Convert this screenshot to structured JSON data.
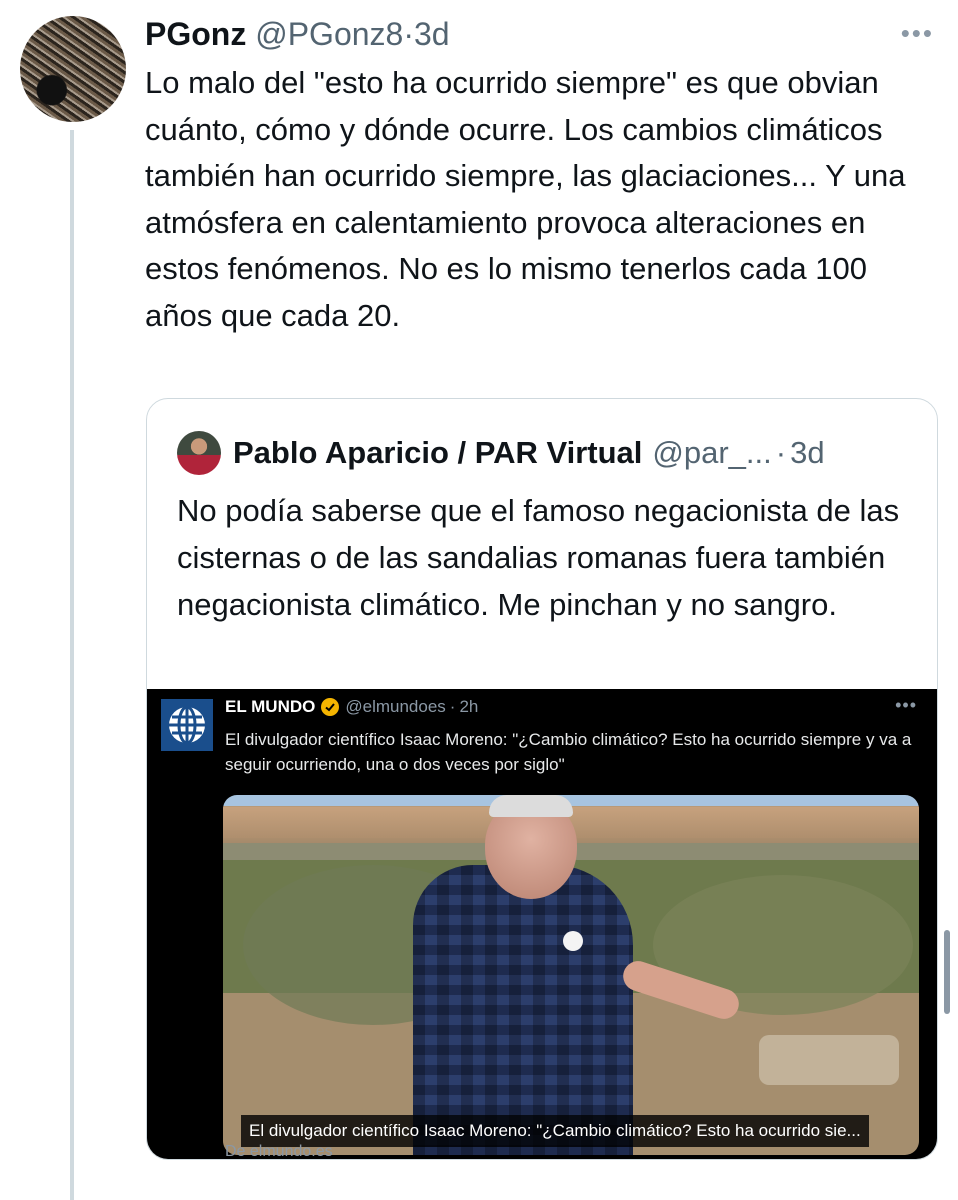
{
  "post": {
    "name": "PGonz",
    "handle": "@PGonz8",
    "separator": "·",
    "time": "3d",
    "more": "•••",
    "text": "Lo malo del \"esto ha ocurrido siempre\" es que obvian cuánto, cómo y dónde ocurre. Los cambios climáticos también han ocurrido siempre, las glaciaciones... Y una atmósfera en calentamiento provoca alteraciones en estos fenómenos. No es lo mismo tenerlos cada 100 años que cada 20."
  },
  "quote": {
    "name": "Pablo Aparicio / PAR Virtual",
    "handle": "@par_...",
    "separator": "·",
    "time": "3d",
    "text": "No podía saberse que el famoso negacionista de las cisternas o de las sandalias romanas fuera también negacionista climático. Me pinchan y no sangro."
  },
  "embedded": {
    "name": "EL MUNDO",
    "handle": "@elmundoes",
    "separator": "·",
    "time": "2h",
    "more": "•••",
    "text": "El divulgador científico Isaac Moreno: \"¿Cambio climático? Esto ha ocurrido siempre y va a seguir ocurriendo, una o dos veces por siglo\"",
    "video_caption": "El divulgador científico Isaac Moreno: \"¿Cambio climático? Esto ha ocurrido sie...",
    "source": "De elmundo.es",
    "verified_color": "#f4b400",
    "logo_color": "#1a4e8c"
  },
  "icons": [
    "avatar",
    "more-icon",
    "verified-icon",
    "globe-logo-icon"
  ]
}
